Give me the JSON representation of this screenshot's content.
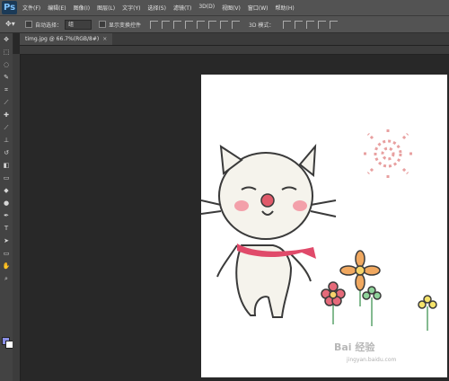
{
  "app": {
    "logo_text": "Ps"
  },
  "menu": [
    "文件(F)",
    "编辑(E)",
    "图像(I)",
    "图层(L)",
    "文字(Y)",
    "选择(S)",
    "滤镜(T)",
    "3D(D)",
    "视图(V)",
    "窗口(W)",
    "帮助(H)"
  ],
  "options": {
    "auto_select_label": "自动选择：",
    "auto_select_value": "组",
    "show_transform_label": "显示变换控件",
    "mode_3d_label": "3D 模式："
  },
  "document": {
    "tab_title": "timg.jpg @ 66.7%(RGB/8#)",
    "close_symbol": "×"
  },
  "tools": [
    "move-tool-icon",
    "marquee-icon",
    "lasso-icon",
    "quick-select-icon",
    "crop-icon",
    "eyedropper-icon",
    "healing-brush-icon",
    "brush-icon",
    "clone-stamp-icon",
    "history-brush-icon",
    "eraser-icon",
    "gradient-icon",
    "blur-icon",
    "dodge-icon",
    "pen-icon",
    "type-icon",
    "path-select-icon",
    "rectangle-icon",
    "hand-icon",
    "zoom-icon"
  ],
  "colors": {
    "foreground": "#8a8fe6",
    "background": "#ffffff",
    "ui_dark": "#282828",
    "ui_panel": "#535353"
  },
  "watermark": {
    "brand": "Bai 经验",
    "url": "jingyan.baidu.com"
  }
}
